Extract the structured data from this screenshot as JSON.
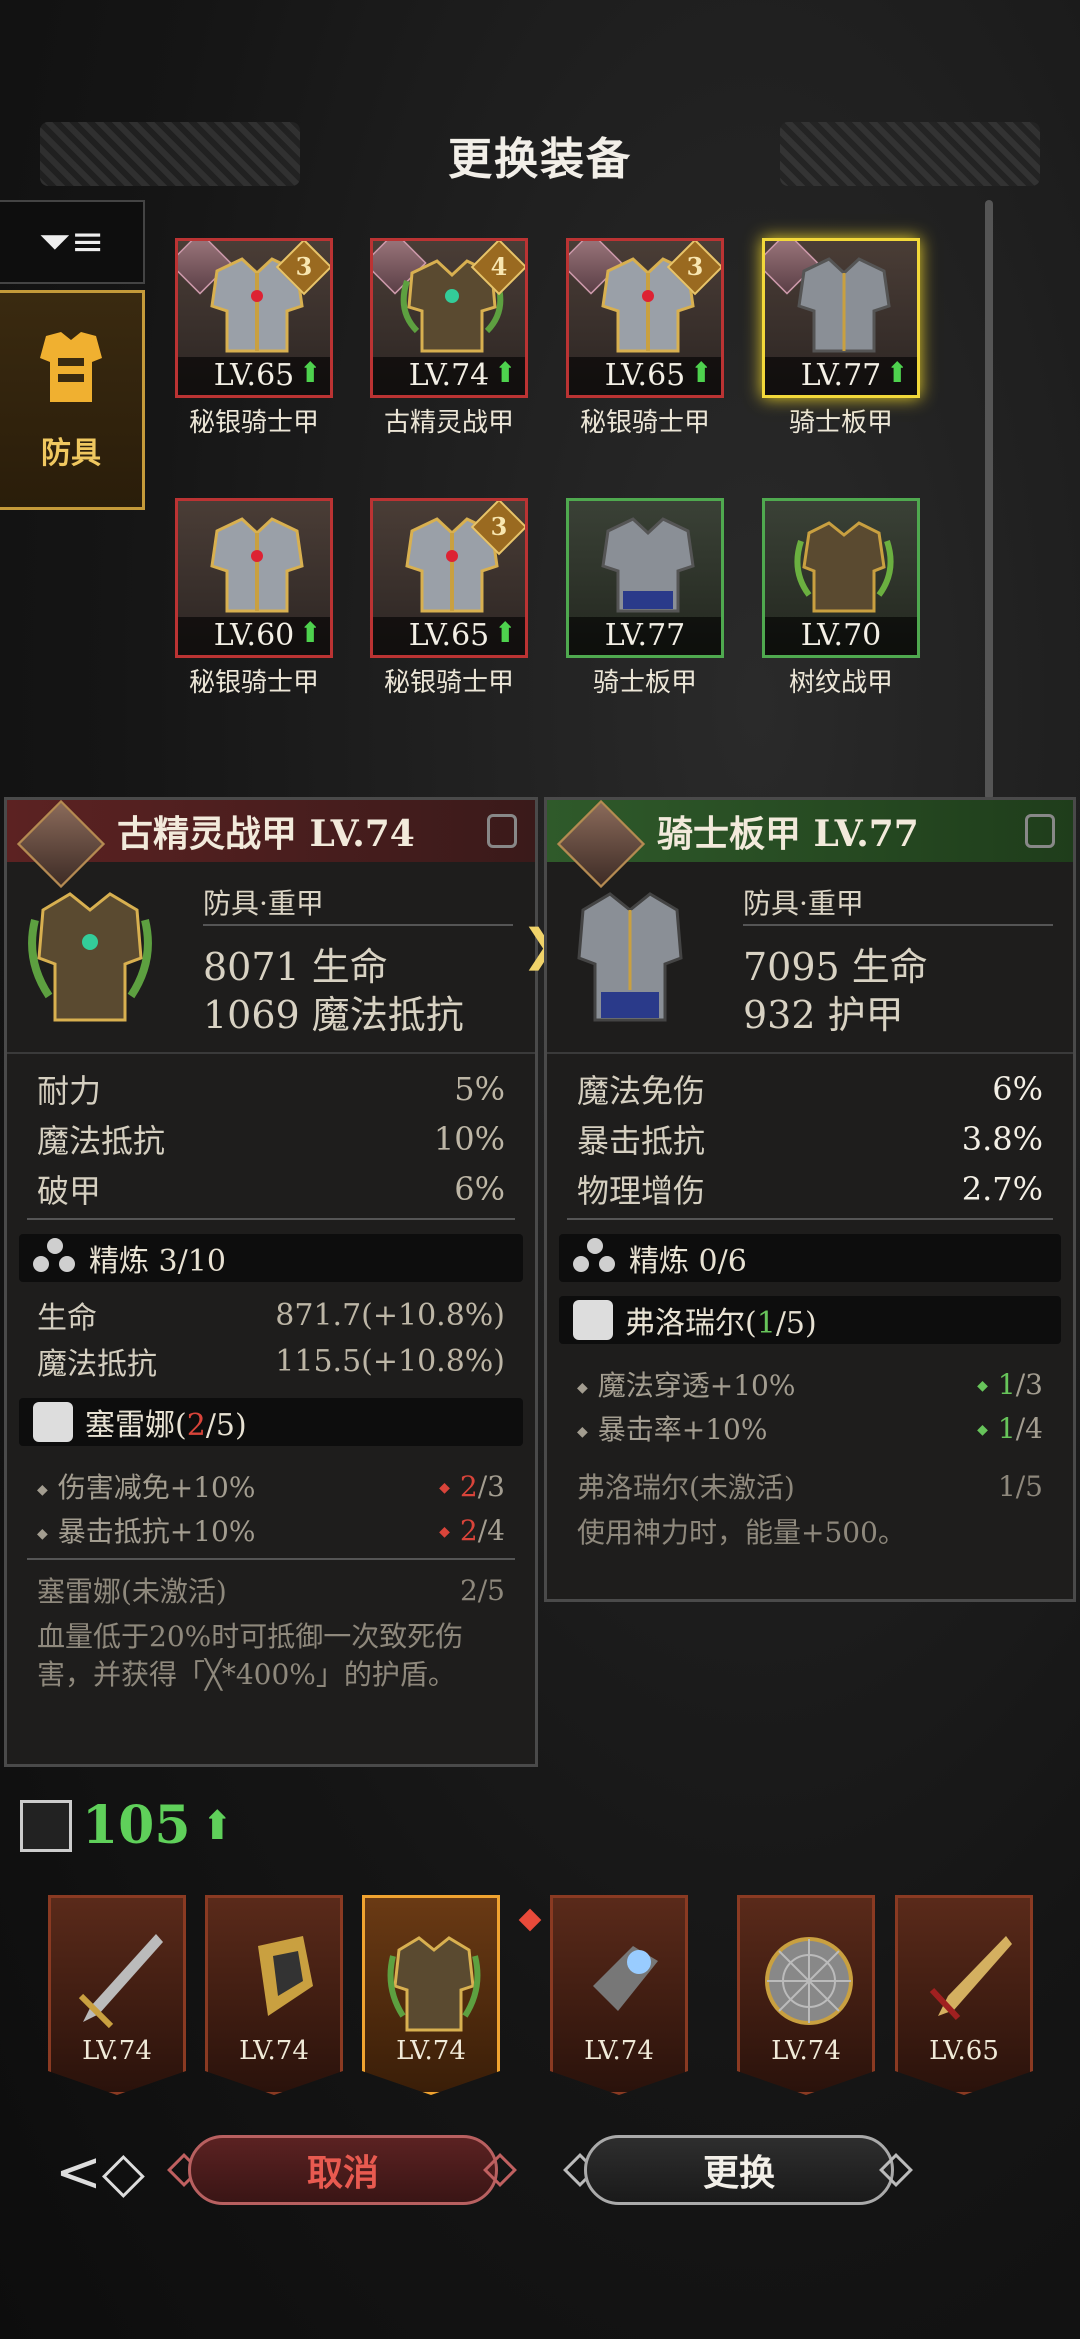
{
  "header": {
    "title": "更换装备"
  },
  "tabs": {
    "armor_label": "防具"
  },
  "grid": [
    {
      "name": "秘银骑士甲",
      "level": "LV.65",
      "up": "⬆",
      "badge": "3",
      "border": "red"
    },
    {
      "name": "古精灵战甲",
      "level": "LV.74",
      "up": "⬆",
      "badge": "4",
      "border": "red"
    },
    {
      "name": "秘银骑士甲",
      "level": "LV.65",
      "up": "⬆",
      "badge": "3",
      "border": "red"
    },
    {
      "name": "骑士板甲",
      "level": "LV.77",
      "up": "⬆",
      "badge": "",
      "border": "gold"
    },
    {
      "name": "秘银骑士甲",
      "level": "LV.60",
      "up": "⬆",
      "badge": "",
      "border": "red"
    },
    {
      "name": "秘银骑士甲",
      "level": "LV.65",
      "up": "⬆",
      "badge": "3",
      "border": "red"
    },
    {
      "name": "骑士板甲",
      "level": "LV.77",
      "up": "",
      "badge": "",
      "border": "green"
    },
    {
      "name": "树纹战甲",
      "level": "LV.70",
      "up": "",
      "badge": "",
      "border": "green"
    }
  ],
  "left_panel": {
    "title": "古精灵战甲 LV.74",
    "type": "防具·重甲",
    "stat1": "8071 生命",
    "stat2": "1069 魔法抵抗",
    "rows": [
      {
        "k": "耐力",
        "v": "5%"
      },
      {
        "k": "魔法抵抗",
        "v": "10%"
      },
      {
        "k": "破甲",
        "v": "6%"
      }
    ],
    "refine_label": "精炼 3/10",
    "refine_rows": [
      {
        "k": "生命",
        "v": "871.7(+10.8%)"
      },
      {
        "k": "魔法抵抗",
        "v": "115.5(+10.8%)"
      }
    ],
    "set_name": "塞雷娜(",
    "set_count": "2",
    "set_total": "/5)",
    "set_rows": [
      {
        "k": "伤害减免+10%",
        "have": "2",
        "need": "/3"
      },
      {
        "k": "暴击抵抗+10%",
        "have": "2",
        "need": "/4"
      }
    ],
    "inactive_name": "塞雷娜(未激活)",
    "inactive_count": "2/5",
    "inactive_desc": "血量低于20%时可抵御一次致死伤害，并获得「╳*400%」的护盾。"
  },
  "right_panel": {
    "title": "骑士板甲 LV.77",
    "type": "防具·重甲",
    "stat1": "7095 生命",
    "stat2": "932 护甲",
    "rows": [
      {
        "k": "魔法免伤",
        "v": "6%"
      },
      {
        "k": "暴击抵抗",
        "v": "3.8%"
      },
      {
        "k": "物理增伤",
        "v": "2.7%"
      }
    ],
    "refine_label": "精炼 0/6",
    "set_name": "弗洛瑞尔(",
    "set_count": "1",
    "set_total": "/5)",
    "set_rows": [
      {
        "k": "魔法穿透+10%",
        "have": "1",
        "need": "/3"
      },
      {
        "k": "暴击率+10%",
        "have": "1",
        "need": "/4"
      }
    ],
    "inactive_name": "弗洛瑞尔(未激活)",
    "inactive_count": "1/5",
    "inactive_desc": "使用神力时，能量+500。"
  },
  "power": {
    "value": "105",
    "up": "⬆"
  },
  "slots": [
    {
      "level": "LV.74",
      "icon": "sword-icon"
    },
    {
      "level": "LV.74",
      "icon": "helmet-icon"
    },
    {
      "level": "LV.74",
      "icon": "armor-icon"
    },
    {
      "level": "LV.74",
      "icon": "gauntlet-icon"
    },
    {
      "level": "LV.74",
      "icon": "shield-icon"
    },
    {
      "level": "LV.65",
      "icon": "dagger-icon"
    }
  ],
  "buttons": {
    "cancel": "取消",
    "swap": "更换"
  },
  "colors": {
    "red": "#d9443a",
    "green": "#67c45a",
    "gold": "#f2d83a"
  }
}
